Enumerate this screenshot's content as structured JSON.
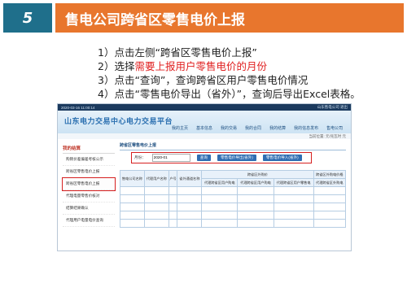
{
  "slide": {
    "number": "5",
    "title": "售电公司跨省区零售电价上报"
  },
  "steps": [
    {
      "prefix": "1）点击左侧“跨省区零售电价上报”",
      "highlight": "",
      "suffix": ""
    },
    {
      "prefix": "2）选择",
      "highlight": "需要上报用户零售电价的月份",
      "suffix": ""
    },
    {
      "prefix": "3）点击“查询”，查询跨省区用户零售电价情况",
      "highlight": "",
      "suffix": ""
    },
    {
      "prefix": "4）点击“零售电价导出（省外）”，查询后导出Excel表格。",
      "highlight": "",
      "suffix": ""
    }
  ],
  "screenshot": {
    "topbar_left": "2020-03-16  11:00:14",
    "topbar_right": "山东售电公司   退出",
    "logo": "山东电力交易中心电力交易平台",
    "nav": [
      "我的主页",
      "基本信息",
      "我的交易",
      "我的合同",
      "我的结算",
      "我的信息发布",
      "售电公司"
    ],
    "sub_info": "当前位置: 元/兆瓦时 元",
    "sidebar_title": "我的结算",
    "sidebar_items": [
      "购销价差偏差考核公示",
      "跨省区零售电价上报",
      "跨省区零售电价上报",
      "代理电量零售价核对",
      "结算结果确认",
      "代理用户电量电价查询"
    ],
    "active_index": 2,
    "panel_title": "跨省区零售电价上报",
    "month_label": "月份：",
    "month_value": "2020-01",
    "query_button": "查询",
    "export_out": "零售电价导出(省外)",
    "export_in": "零售电价导入(省外)",
    "table_header_row1": [
      "售电公司名称",
      "代理用户名称",
      "户号",
      "省外通道名称",
      "跨省区外购价",
      "",
      "",
      "跨省区外购电价格"
    ],
    "table_header_row2": [
      "",
      "",
      "",
      "",
      "代理跨省区用户购电",
      "代理跨省区用户购电",
      "代理跨省区用户零售电",
      "代理跨省区外购电"
    ],
    "table_rows": [
      [
        "",
        "",
        "",
        "",
        "",
        "",
        "",
        ""
      ],
      [
        "",
        "",
        "",
        "",
        "",
        "",
        "",
        ""
      ],
      [
        "",
        "",
        "",
        "",
        "",
        "",
        "",
        ""
      ],
      [
        "",
        "",
        "",
        "",
        "",
        "",
        "",
        ""
      ],
      [
        "",
        "",
        "",
        "",
        "",
        "",
        "",
        ""
      ]
    ]
  }
}
